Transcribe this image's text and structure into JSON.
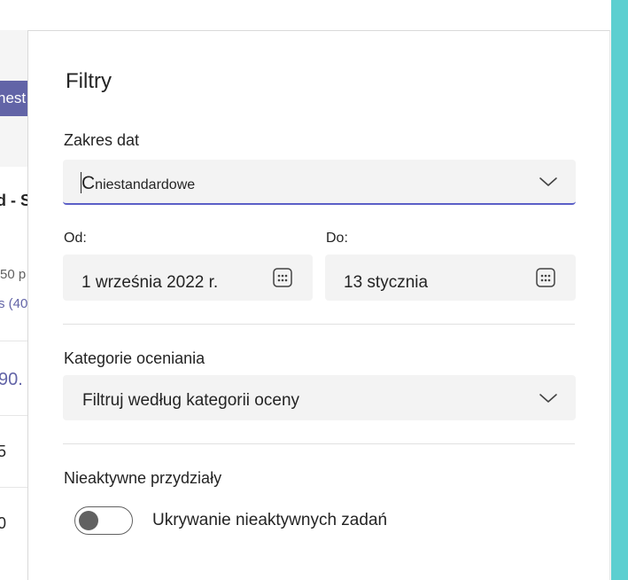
{
  "background": {
    "button_partial": "nest",
    "heading_partial": "d - S",
    "meta_partial": "50 p",
    "link_partial": "s (40",
    "row_values": [
      "90.",
      "5",
      "0"
    ]
  },
  "panel": {
    "title": "Filtry",
    "date_range": {
      "label": "Zakres dat",
      "value": "niestandardowe",
      "value_prefix": "C"
    },
    "from": {
      "label": "Od:",
      "value": "1 września 2022 r."
    },
    "to": {
      "label": "Do:",
      "value": "13 stycznia"
    },
    "grading_categories": {
      "label": "Kategorie oceniania",
      "placeholder": "Filtruj według kategorii oceny"
    },
    "inactive": {
      "label": "Nieaktywne przydziały",
      "toggle_label": "Ukrywanie nieaktywnych zadań",
      "toggle_on": false
    }
  },
  "colors": {
    "accent": "#5b5fc7",
    "teal": "#5ccfd0",
    "purple": "#6264a7"
  }
}
